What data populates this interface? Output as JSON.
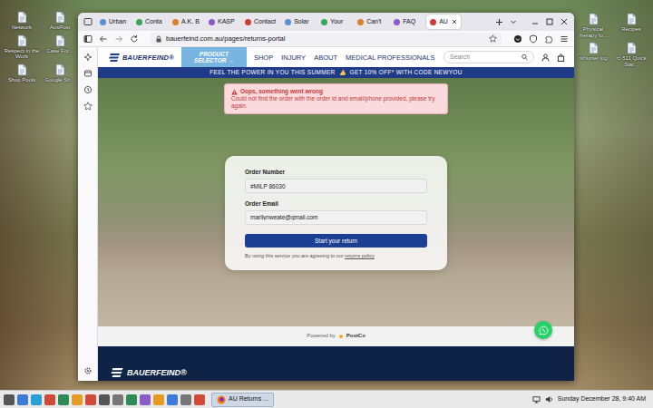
{
  "desktop": {
    "left_icons": [
      {
        "label": "Network"
      },
      {
        "label": "AusPost"
      },
      {
        "label": "Respect in the Work"
      },
      {
        "label": "Case For..."
      },
      {
        "label": "Shop Pools"
      },
      {
        "label": "Google Sh..."
      }
    ],
    "right_icons": [
      {
        "label": "Physical therapy fo..."
      },
      {
        "label": "Recipes"
      },
      {
        "label": "rkhunter.log"
      },
      {
        "label": "rc-511 Quick Star..."
      }
    ]
  },
  "browser": {
    "tabs": [
      {
        "label": "Urban",
        "selected": false
      },
      {
        "label": "Conta",
        "selected": false
      },
      {
        "label": "A.K. B",
        "selected": false
      },
      {
        "label": "KASP",
        "selected": false
      },
      {
        "label": "Contact",
        "selected": false
      },
      {
        "label": "Solar",
        "selected": false
      },
      {
        "label": "Your",
        "selected": false
      },
      {
        "label": "Can't",
        "selected": false
      },
      {
        "label": "FAQ",
        "selected": false
      },
      {
        "label": "AU",
        "selected": true
      }
    ],
    "url": "bauerfeind.com.au/pages/returns-portal"
  },
  "site": {
    "logo": "BAUERFEIND®",
    "product_selector": "PRODUCT SELECTOR →",
    "nav": [
      {
        "label": "SHOP"
      },
      {
        "label": "INJURY"
      },
      {
        "label": "ABOUT"
      },
      {
        "label": "MEDICAL PROFESSIONALS"
      }
    ],
    "search": {
      "placeholder": "Search"
    },
    "promo": [
      "FEEL THE POWER IN YOU THIS SUMMER",
      "GET 10% OFF* WITH CODE NEWYOU"
    ],
    "alert": {
      "title": "Oops, something went wrong",
      "message": "Could not find the order with the order id and email/phone provided, please try again."
    },
    "form": {
      "fields": [
        {
          "label": "Order Number",
          "value": "#MILP 86030"
        },
        {
          "label": "Order Email",
          "value": "marilynweate@gmail.com"
        }
      ],
      "submit": "Start your return",
      "consent": "By using this service you are agreeing to our",
      "consent_link": "returns policy"
    },
    "powered_by": {
      "label": "Powered by",
      "brand": "PostCo"
    },
    "footer_logo": "BAUERFEIND®"
  },
  "taskbar": {
    "active_task": "AU Returns ...",
    "clock": "Sunday December 28, 9:40 AM"
  }
}
